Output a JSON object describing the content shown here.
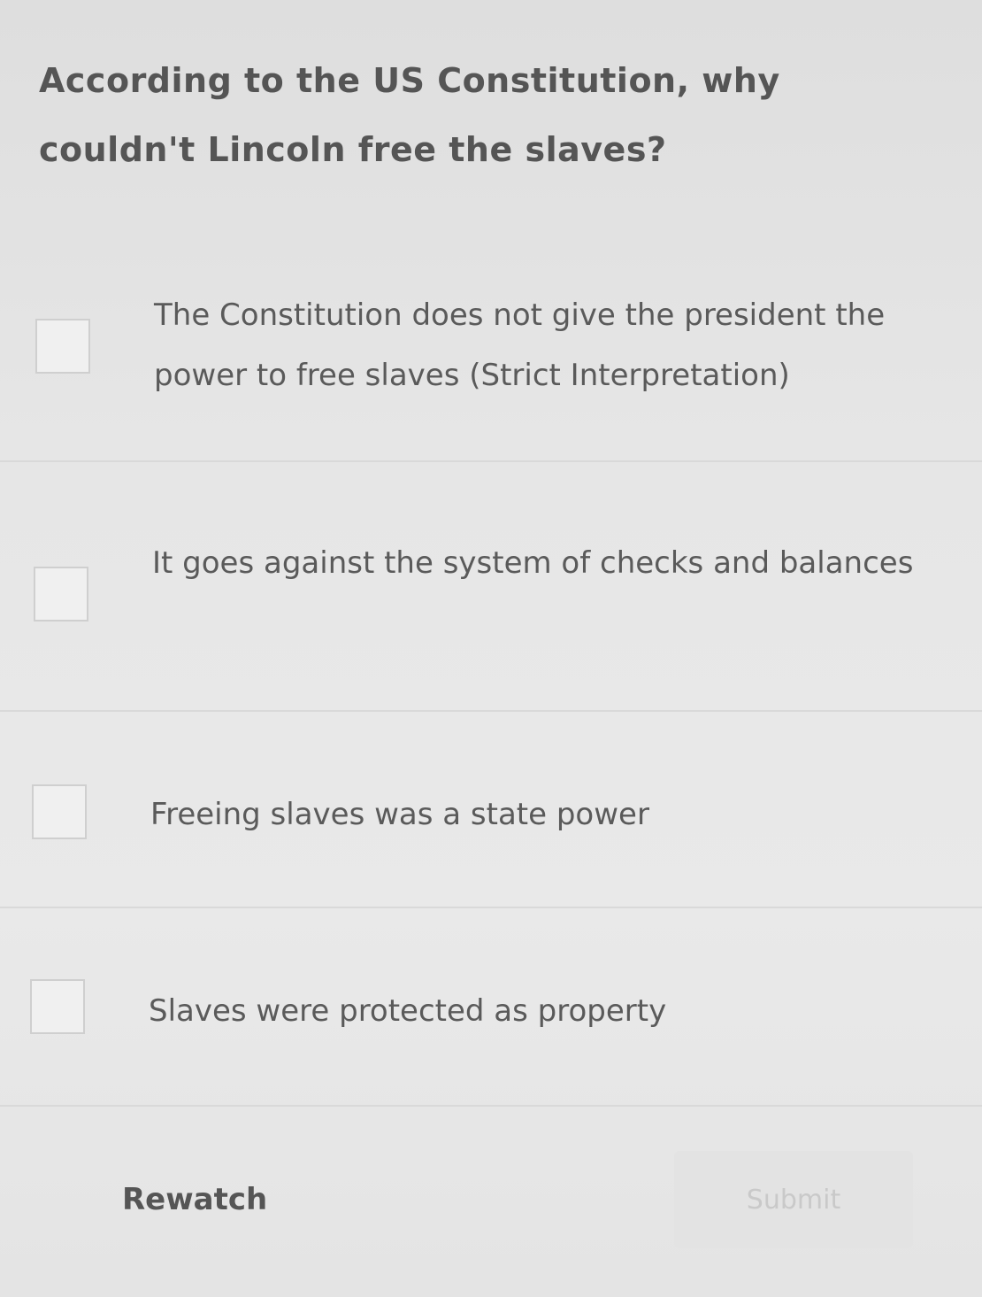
{
  "question": {
    "text": "According to the US Constitution, why couldn't Lincoln free the slaves?"
  },
  "options": [
    {
      "label": "The Constitution does not give the president the power to free slaves (Strict Interpretation)",
      "checked": false
    },
    {
      "label": "It goes against the system of checks and balances",
      "checked": false
    },
    {
      "label": "Freeing slaves was a state power",
      "checked": false
    },
    {
      "label": "Slaves were protected as property",
      "checked": false
    }
  ],
  "actions": {
    "rewatch_label": "Rewatch",
    "submit_label": "Submit",
    "submit_enabled": false
  }
}
